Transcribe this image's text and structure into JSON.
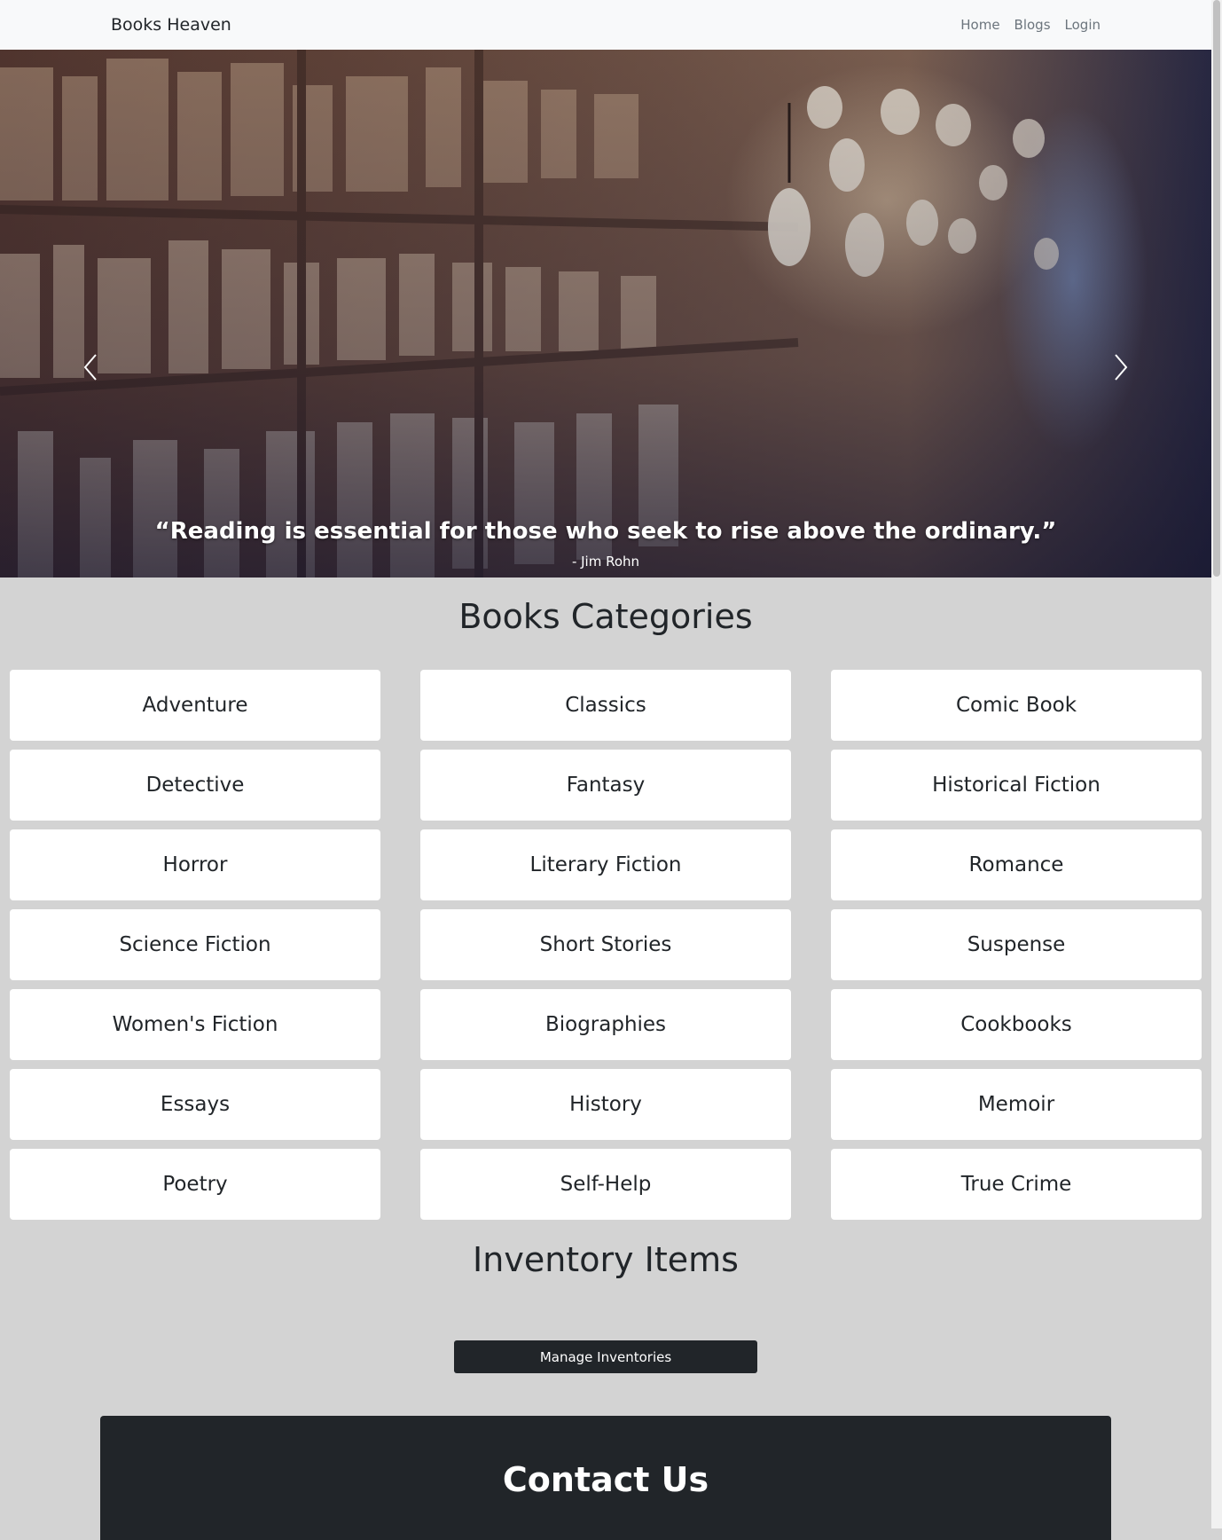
{
  "navbar": {
    "brand": "Books Heaven",
    "links": [
      "Home",
      "Blogs",
      "Login"
    ]
  },
  "hero": {
    "quote": "“Reading is essential for those who seek to rise above the ordinary.”",
    "author": "- Jim Rohn",
    "slide_count": 3,
    "active_slide": 2
  },
  "categories": {
    "title": "Books Categories",
    "items": [
      "Adventure",
      "Classics",
      "Comic Book",
      "Detective",
      "Fantasy",
      "Historical Fiction",
      "Horror",
      "Literary Fiction",
      "Romance",
      "Science Fiction",
      "Short Stories",
      "Suspense",
      "Women's Fiction",
      "Biographies",
      "Cookbooks",
      "Essays",
      "History",
      "Memoir",
      "Poetry",
      "Self-Help",
      "True Crime"
    ]
  },
  "inventory": {
    "title": "Inventory Items",
    "manage_button": "Manage Inventories"
  },
  "contact": {
    "title": "Contact Us"
  },
  "colors": {
    "page_background": "#d3d3d3",
    "navbar_background": "#f8f9fa",
    "dark": "#212529",
    "card_background": "#ffffff"
  }
}
